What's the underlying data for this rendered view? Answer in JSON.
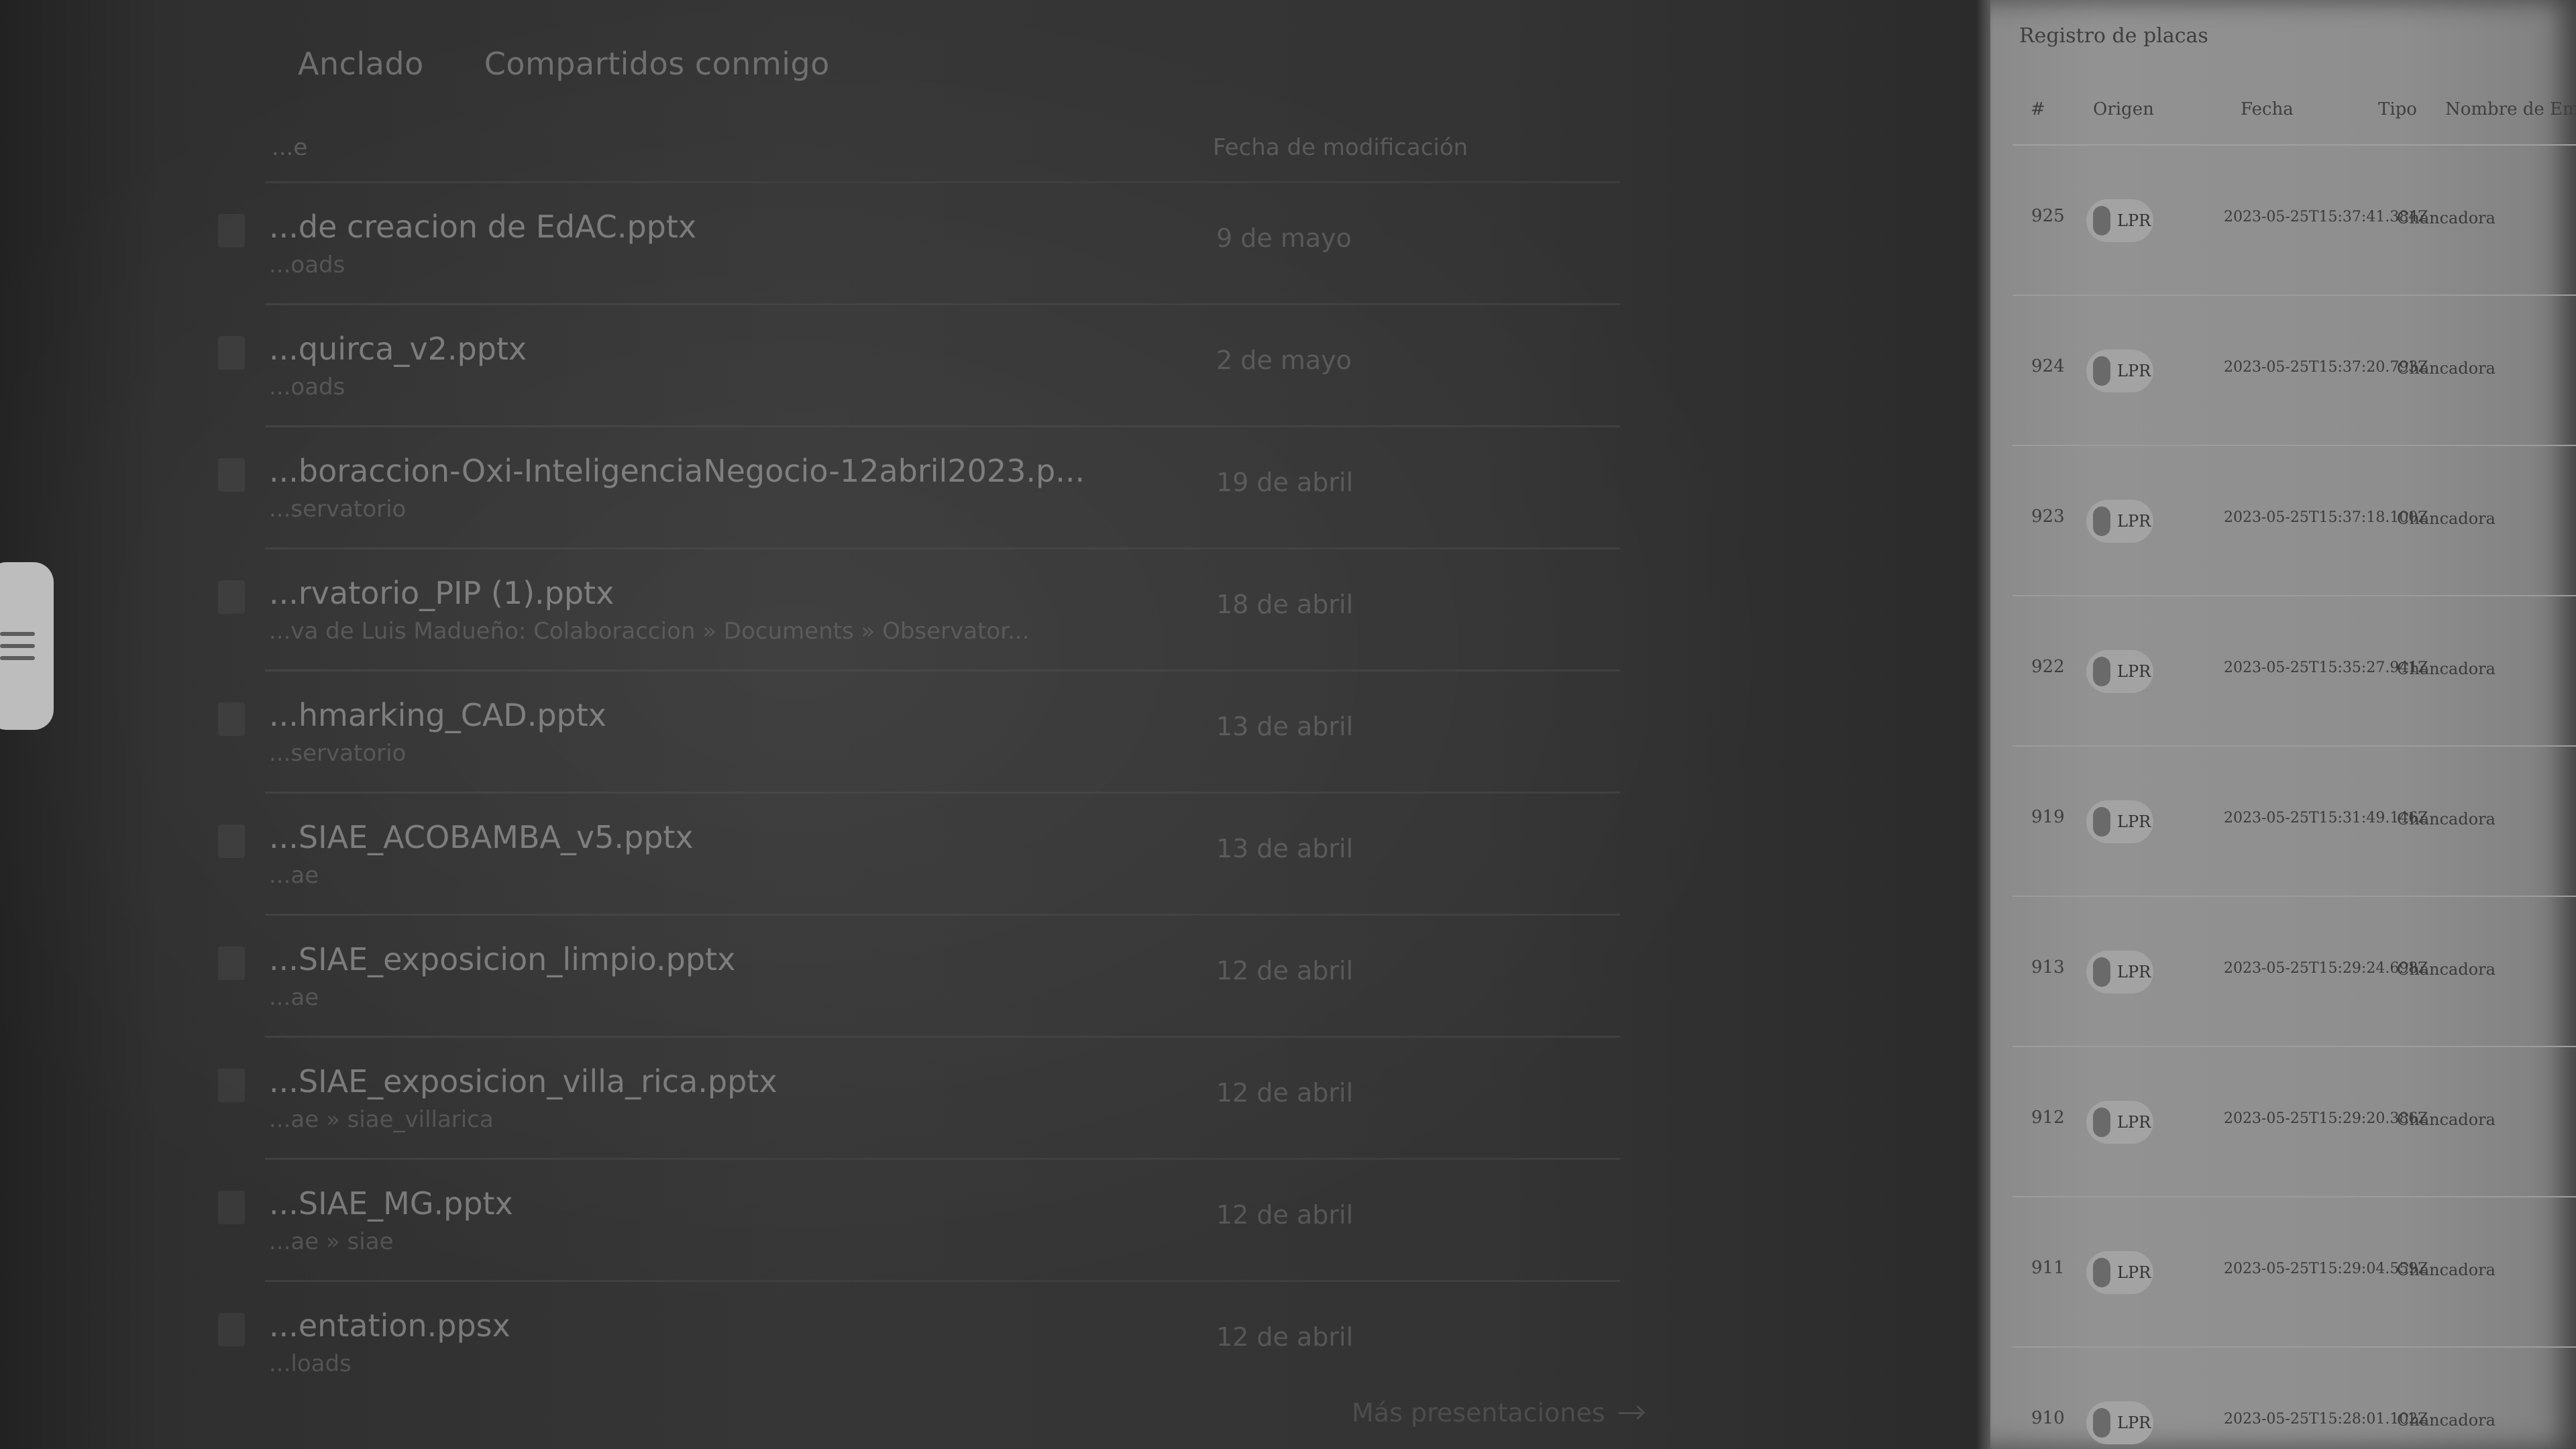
{
  "files_panel": {
    "tabs": [
      {
        "label": "Anclado"
      },
      {
        "label": "Compartidos conmigo"
      }
    ],
    "columns": {
      "name": "...e",
      "date": "Fecha de modificación"
    },
    "files": [
      {
        "name": "...de creacion de EdAC.pptx",
        "path": "...oads",
        "date": "9 de mayo"
      },
      {
        "name": "...quirca_v2.pptx",
        "path": "...oads",
        "date": "2 de mayo"
      },
      {
        "name": "...boraccion-Oxi-InteligenciaNegocio-12abril2023.p...",
        "path": "...servatorio",
        "date": "19 de abril"
      },
      {
        "name": "...rvatorio_PIP (1).pptx",
        "path": "...va de Luis Madueño: Colaboraccion » Documents » Observator...",
        "date": "18 de abril"
      },
      {
        "name": "...hmarking_CAD.pptx",
        "path": "...servatorio",
        "date": "13 de abril"
      },
      {
        "name": "...SIAE_ACOBAMBA_v5.pptx",
        "path": "...ae",
        "date": "13 de abril"
      },
      {
        "name": "...SIAE_exposicion_limpio.pptx",
        "path": "...ae",
        "date": "12 de abril"
      },
      {
        "name": "...SIAE_exposicion_villa_rica.pptx",
        "path": "...ae » siae_villarica",
        "date": "12 de abril"
      },
      {
        "name": "...SIAE_MG.pptx",
        "path": "...ae » siae",
        "date": "12 de abril"
      },
      {
        "name": "...entation.ppsx",
        "path": "...loads",
        "date": "12 de abril"
      }
    ],
    "more_link": "Más presentaciones"
  },
  "plates_panel": {
    "title": "Registro de placas",
    "headers": {
      "num": "#",
      "origen": "Origen",
      "fecha": "Fecha",
      "tipo": "Tipo",
      "empresa": "Nombre de Empresa"
    },
    "rows": [
      {
        "id": "925",
        "origen": "LPR",
        "fecha": "2023-05-25T15:37:41.384Z",
        "tipo": "Chancadora"
      },
      {
        "id": "924",
        "origen": "LPR",
        "fecha": "2023-05-25T15:37:20.793Z",
        "tipo": "Chancadora"
      },
      {
        "id": "923",
        "origen": "LPR",
        "fecha": "2023-05-25T15:37:18.100Z",
        "tipo": "Chancadora"
      },
      {
        "id": "922",
        "origen": "LPR",
        "fecha": "2023-05-25T15:35:27.941Z",
        "tipo": "Chancadora"
      },
      {
        "id": "919",
        "origen": "LPR",
        "fecha": "2023-05-25T15:31:49.146Z",
        "tipo": "Chancadora"
      },
      {
        "id": "913",
        "origen": "LPR",
        "fecha": "2023-05-25T15:29:24.698Z",
        "tipo": "Chancadora"
      },
      {
        "id": "912",
        "origen": "LPR",
        "fecha": "2023-05-25T15:29:20.386Z",
        "tipo": "Chancadora"
      },
      {
        "id": "911",
        "origen": "LPR",
        "fecha": "2023-05-25T15:29:04.559Z",
        "tipo": "Chancadora"
      },
      {
        "id": "910",
        "origen": "LPR",
        "fecha": "2023-05-25T15:28:01.102Z",
        "tipo": "Chancadora"
      }
    ]
  },
  "colors": {
    "page_bg": "#2a2a2a",
    "panel_light": "#929292"
  },
  "icons": {
    "menu": "hamburger-icon",
    "more": "arrow-right-icon",
    "camera": "camera-icon"
  }
}
